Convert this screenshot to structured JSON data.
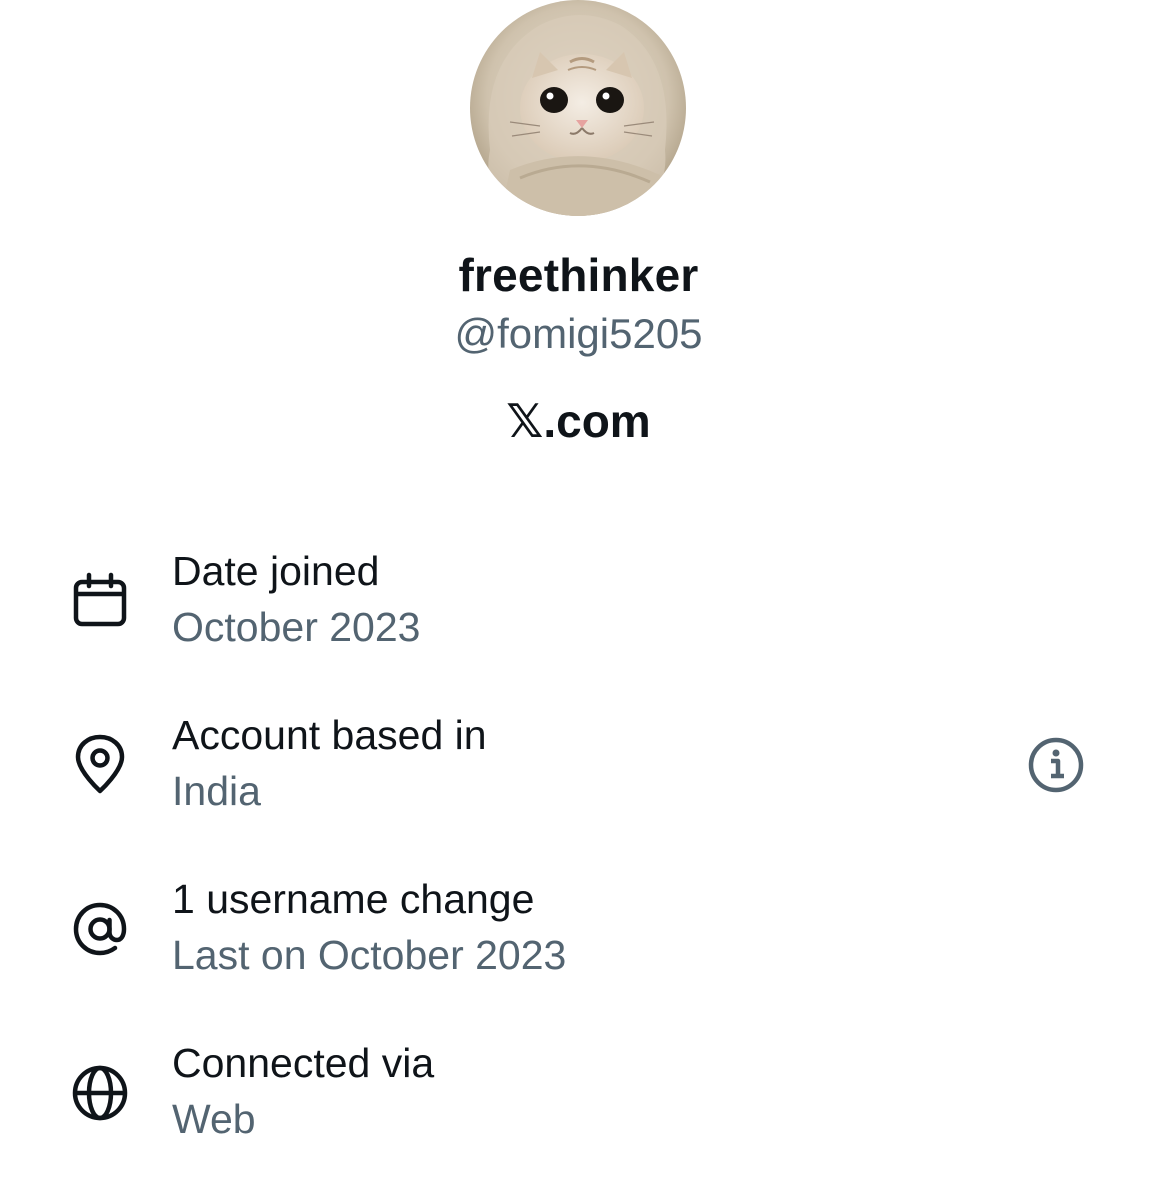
{
  "profile": {
    "display_name": "freethinker",
    "handle": "@fomigi5205",
    "site": "𝕏.com"
  },
  "about": {
    "rows": [
      {
        "icon": "calendar-icon",
        "title": "Date joined",
        "value": "October 2023"
      },
      {
        "icon": "location-pin-icon",
        "title": "Account based in",
        "value": "India"
      },
      {
        "icon": "at-sign-icon",
        "title": "1 username change",
        "value": "Last on October 2023"
      },
      {
        "icon": "globe-icon",
        "title": "Connected via",
        "value": "Web"
      }
    ],
    "info_icon": "info-icon"
  },
  "colors": {
    "primary_text": "#0f1419",
    "secondary_text": "#536471",
    "background": "#ffffff"
  }
}
